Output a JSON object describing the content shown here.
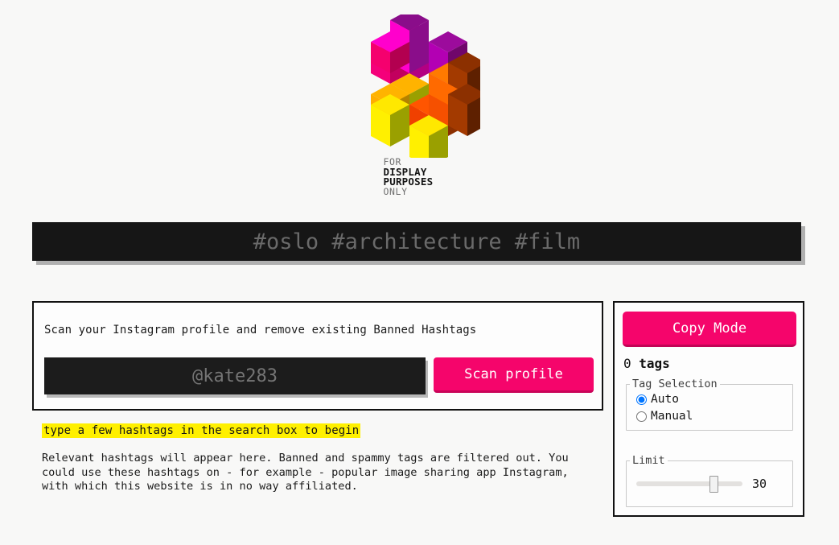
{
  "page": {
    "background_color": "#f8f8f7",
    "accent_color": "#f5056b",
    "highlight_color": "#fff000"
  },
  "logo": {
    "icon_name": "isometric-hashtag-logo",
    "wordmark_line1": "FOR",
    "wordmark_line2": "DISPLAY",
    "wordmark_line3": "PURPOSES",
    "wordmark_line4": "ONLY",
    "block_colors": {
      "magenta": "#ff00c8",
      "magenta_dark": "#b3008c",
      "magenta_side": "#d9009f",
      "pink": "#f50a6e",
      "pink_dark": "#a8044b",
      "purple": "#8e0b8e",
      "purple_dark": "#6b0668",
      "orange": "#ff6a00",
      "orange_dark": "#b34500",
      "brown": "#8c3000",
      "brown_dark": "#5e2000",
      "yellow": "#ffe800",
      "yellow_dark": "#b3a200",
      "amber": "#ffae00",
      "olive": "#9aa000",
      "red_orange": "#f03c00"
    }
  },
  "search": {
    "value": "",
    "placeholder": "#oslo #architecture #film"
  },
  "scan_panel": {
    "description": "Scan your Instagram profile and remove existing Banned Hashtags",
    "input_value": "",
    "input_placeholder": "@kate283",
    "scan_button_label": "Scan profile"
  },
  "results": {
    "hint": "type a few hashtags in the search box to begin",
    "info": "Relevant hashtags will appear here. Banned and spammy tags are filtered out. You could use these hashtags on - for example - popular image sharing app Instagram, with which this website is in no way affiliated."
  },
  "sidebar": {
    "copy_mode_label": "Copy Mode",
    "tag_count_number": "0",
    "tag_count_word": "tags",
    "tag_selection": {
      "legend": "Tag Selection",
      "options": [
        {
          "label": "Auto",
          "value": "auto",
          "selected": true
        },
        {
          "label": "Manual",
          "value": "manual",
          "selected": false
        }
      ]
    },
    "limit": {
      "legend": "Limit",
      "value": "30",
      "min": "0",
      "max": "40"
    }
  }
}
